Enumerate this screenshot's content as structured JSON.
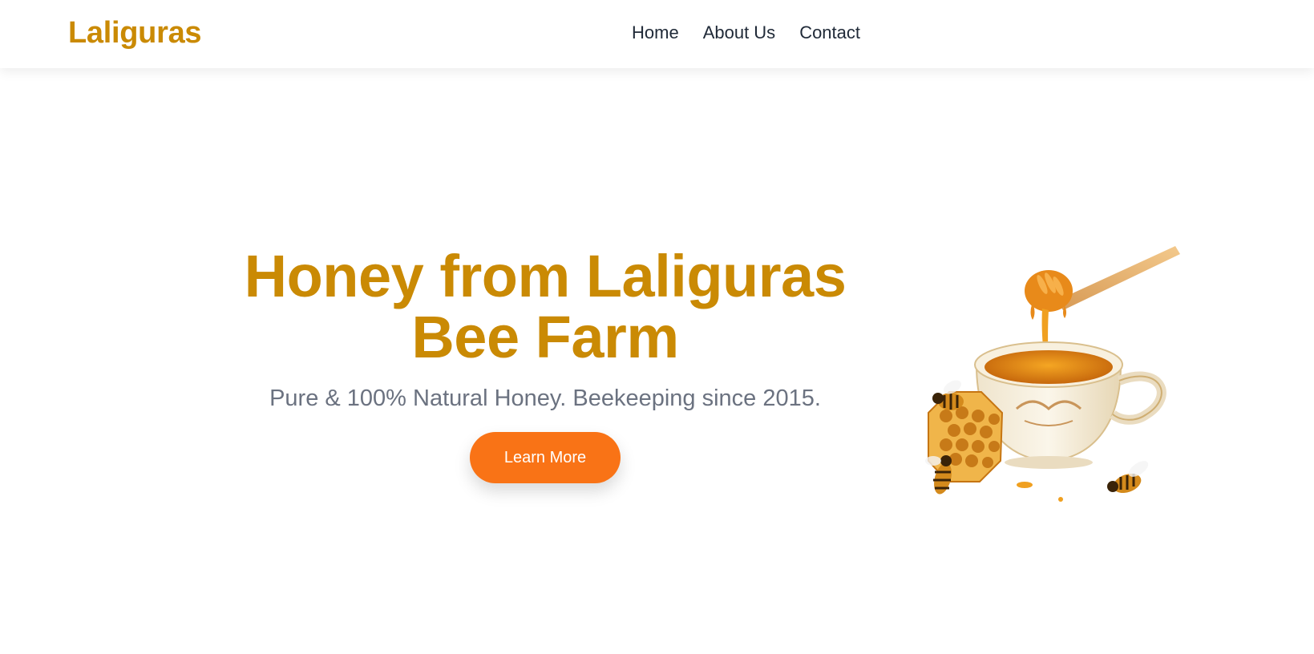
{
  "navbar": {
    "brand": "Laliguras",
    "links": [
      "Home",
      "About Us",
      "Contact"
    ]
  },
  "hero": {
    "title_line1": "Honey from Laliguras",
    "title_line2": "Bee Farm",
    "subtitle": "Pure & 100% Natural Honey. Beekeeping since 2015.",
    "cta_label": "Learn More",
    "image_icon": "honey-cup-with-bees-illustration"
  },
  "colors": {
    "brand": "#ca8a04",
    "accent": "#f97316",
    "text": "#1f2937",
    "muted": "#6b7280"
  }
}
